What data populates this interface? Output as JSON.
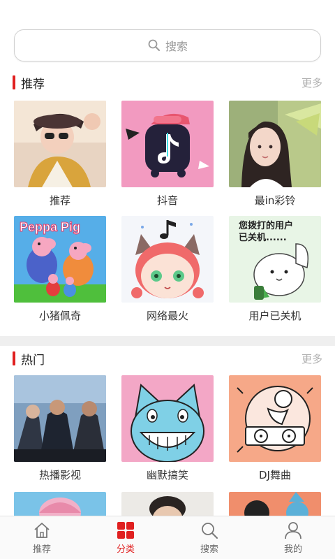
{
  "search": {
    "placeholder": "搜索",
    "icon": "search-icon"
  },
  "recommend": {
    "title": "推荐",
    "more": "更多",
    "items": [
      {
        "label": "推荐"
      },
      {
        "label": "抖音"
      },
      {
        "label": "最in彩铃"
      },
      {
        "label": "小猪佩奇",
        "art_text": "Peppa Pig"
      },
      {
        "label": "网络最火"
      },
      {
        "label": "用户已关机",
        "art_text": "您拨打的用户已关机......"
      }
    ]
  },
  "hot": {
    "title": "热门",
    "more": "更多",
    "items": [
      {
        "label": "热播影视"
      },
      {
        "label": "幽默搞笑"
      },
      {
        "label": "DJ舞曲"
      }
    ]
  },
  "tabbar": {
    "items": [
      {
        "label": "推荐",
        "icon": "home-icon",
        "active": false
      },
      {
        "label": "分类",
        "icon": "category-icon",
        "active": true
      },
      {
        "label": "搜索",
        "icon": "search-icon",
        "active": false
      },
      {
        "label": "我的",
        "icon": "user-icon",
        "active": false
      }
    ]
  },
  "colors": {
    "accent": "#e02020",
    "muted": "#b0b0b0",
    "divider": "#efefef"
  }
}
